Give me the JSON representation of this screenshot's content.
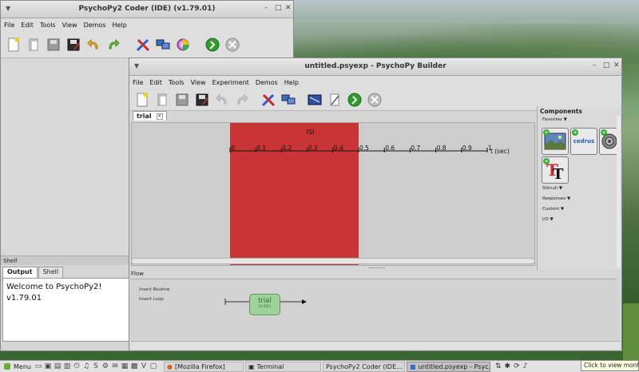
{
  "coder": {
    "title": "PsychoPy2 Coder (IDE) (v1.79.01)",
    "menu": [
      "File",
      "Edit",
      "Tools",
      "View",
      "Demos",
      "Help"
    ],
    "shelf_label": "Shelf",
    "shelf_tabs": [
      "Output",
      "Shell"
    ],
    "output_lines": [
      "Welcome to PsychoPy2!",
      "v1.79.01"
    ]
  },
  "builder": {
    "title": "untitled.psyexp - PsychoPy Builder",
    "menu": [
      "File",
      "Edit",
      "Tools",
      "View",
      "Experiment",
      "Demos",
      "Help"
    ],
    "routine_tab": "trial",
    "routine_tab_close": "×",
    "timeline": {
      "component": "ISI",
      "ticks": [
        "0",
        "0.1",
        "0.2",
        "0.3",
        "0.4",
        "0.5",
        "0.6",
        "0.7",
        "0.8",
        "0.9",
        "1"
      ],
      "unit": "t (sec)",
      "block_start": 0.0,
      "block_end": 0.5
    },
    "components": {
      "header": "Components",
      "categories": [
        "Favorites ▼",
        "Stimuli ▼",
        "Responses ▼",
        "Custom ▼",
        "I/O ▼"
      ],
      "cedrus_label": "cedrus"
    },
    "flow": {
      "label": "Flow",
      "insert_routine": "Insert Routine",
      "insert_loop": "Insert Loop",
      "routine_name": "trial",
      "routine_duration": "(0.50s)"
    }
  },
  "taskbar": {
    "menu_label": "Menu",
    "tasks": [
      "[Mozilla Firefox]",
      "Terminal",
      "PsychoPy2 Coder (IDE...",
      "untitled.psyexp - Psyc..."
    ],
    "tooltip": "Click to view month c"
  },
  "colors": {
    "isi_block": "#c93535",
    "flow_routine": "#9ed29a"
  }
}
